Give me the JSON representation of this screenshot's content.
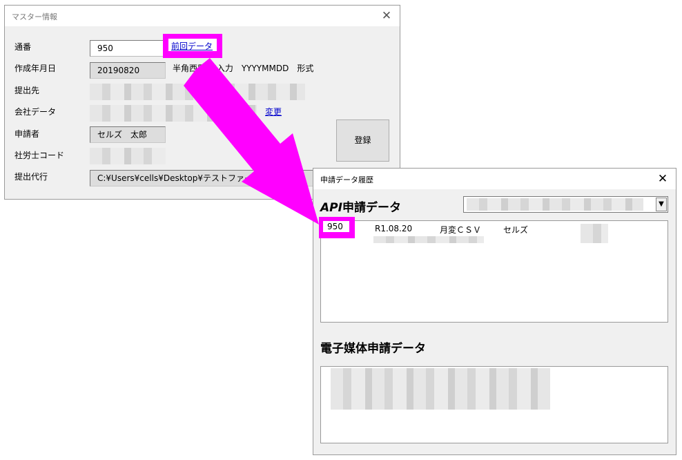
{
  "master_window": {
    "title": "マスター情報",
    "fields": {
      "serial": {
        "label": "通番",
        "value": "950"
      },
      "created_date": {
        "label": "作成年月日",
        "value": "20190820",
        "hint": "半角西暦 で入力　YYYYMMDD　形式"
      },
      "submit_to": {
        "label": "提出先"
      },
      "company": {
        "label": "会社データ"
      },
      "applicant": {
        "label": "申請者",
        "value": "セルズ　太郎"
      },
      "sharoushi_code": {
        "label": "社労士コード"
      },
      "agent": {
        "label": "提出代行",
        "value": "C:¥Users¥cells¥Desktop¥テストファイル.pdf"
      }
    },
    "prev_data_link": "前回データ",
    "change_link": "変更",
    "register_button": "登録"
  },
  "history_window": {
    "title": "申請データ履歴",
    "api_section": {
      "heading_api": "API",
      "heading_rest": "申請データ",
      "rows": [
        {
          "serial": "950",
          "date": "R1.08.20",
          "type": "月変ＣＳＶ",
          "name": "セルズ"
        }
      ]
    },
    "media_section": {
      "heading": "電子媒体申請データ"
    }
  },
  "colors": {
    "highlight": "#ff00ff",
    "link": "#0000cc",
    "window_bg": "#f0f0f0"
  }
}
